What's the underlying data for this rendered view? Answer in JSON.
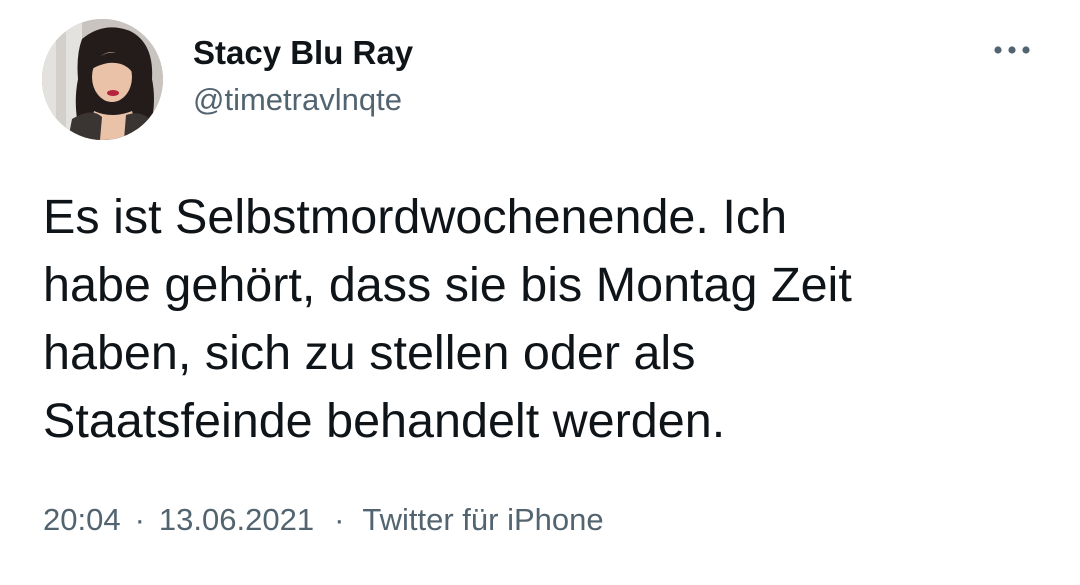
{
  "author": {
    "display_name": "Stacy Blu Ray",
    "handle": "@timetravlnqte"
  },
  "tweet": {
    "text_lines": [
      "Es ist Selbstmordwochenende. Ich",
      "habe gehört, dass sie bis Montag Zeit",
      "haben, sich zu stellen oder als",
      "Staatsfeinde behandelt werden."
    ]
  },
  "meta": {
    "time": "20:04",
    "separator": "·",
    "date": "13.06.2021",
    "source": "Twitter für iPhone"
  },
  "icons": {
    "more": "more-horizontal-icon",
    "avatar": "profile-photo"
  },
  "colors": {
    "text_primary": "#0f1419",
    "text_secondary": "#536471",
    "background": "#ffffff"
  }
}
